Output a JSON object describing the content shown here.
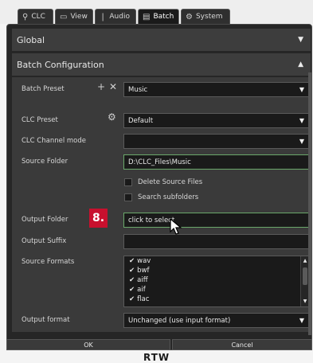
{
  "tabs": [
    {
      "label": "CLC",
      "icon": "clc-icon"
    },
    {
      "label": "View",
      "icon": "view-icon"
    },
    {
      "label": "Audio",
      "icon": "audio-icon"
    },
    {
      "label": "Batch",
      "icon": "batch-icon",
      "active": true
    },
    {
      "label": "System",
      "icon": "gear-icon"
    }
  ],
  "global": {
    "title": "Global"
  },
  "batch_config": {
    "title": "Batch Configuration",
    "rows": {
      "batch_preset": {
        "label": "Batch Preset",
        "value": "Music"
      },
      "clc_preset": {
        "label": "CLC Preset",
        "value": "Default"
      },
      "clc_channel_mode": {
        "label": "CLC Channel mode",
        "value": ""
      },
      "source_folder": {
        "label": "Source Folder",
        "value": "D:\\CLC_Files\\Music"
      },
      "delete_source": {
        "label": "Delete Source Files"
      },
      "search_sub": {
        "label": "Search subfolders"
      },
      "output_folder": {
        "label": "Output Folder",
        "value": "click to select"
      },
      "output_suffix": {
        "label": "Output Suffix",
        "value": ""
      },
      "source_formats": {
        "label": "Source Formats",
        "items": [
          "wav",
          "bwf",
          "aiff",
          "aif",
          "flac"
        ]
      },
      "output_format": {
        "label": "Output format",
        "value": "Unchanged (use input format)"
      }
    }
  },
  "badge": "8.",
  "buttons": {
    "ok": "OK",
    "cancel": "Cancel"
  },
  "logo": "RTW"
}
